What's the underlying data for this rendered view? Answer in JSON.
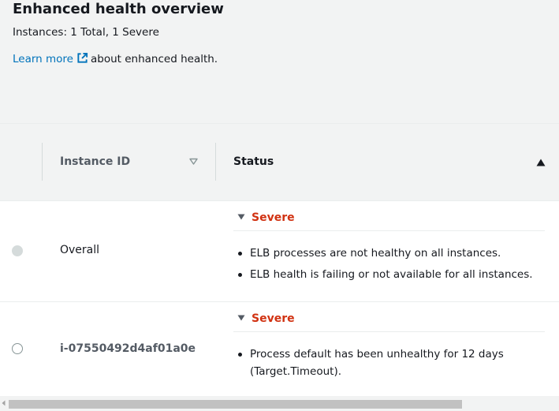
{
  "header": {
    "title": "Enhanced health overview",
    "summary": "Instances: 1 Total, 1 Severe",
    "learn_more_link": "Learn more",
    "learn_more_suffix": "about enhanced health."
  },
  "table": {
    "columns": [
      "Instance ID",
      "Status"
    ],
    "rows": [
      {
        "instance_id": "Overall",
        "status": "Severe",
        "causes": [
          "ELB processes are not healthy on all instances.",
          "ELB health is failing or not available for all instances."
        ]
      },
      {
        "instance_id": "i-07550492d4af01a0e",
        "status": "Severe",
        "causes": [
          "Process default has been unhealthy for 12 days (Target.Timeout)."
        ]
      }
    ]
  },
  "colors": {
    "severe": "#d13212",
    "link": "#0073bb",
    "header_bg": "#f2f3f3"
  },
  "icons": [
    "external-link-icon",
    "sort-descending-icon",
    "sort-ascending-icon",
    "caret-down-icon",
    "scroll-left-icon"
  ]
}
